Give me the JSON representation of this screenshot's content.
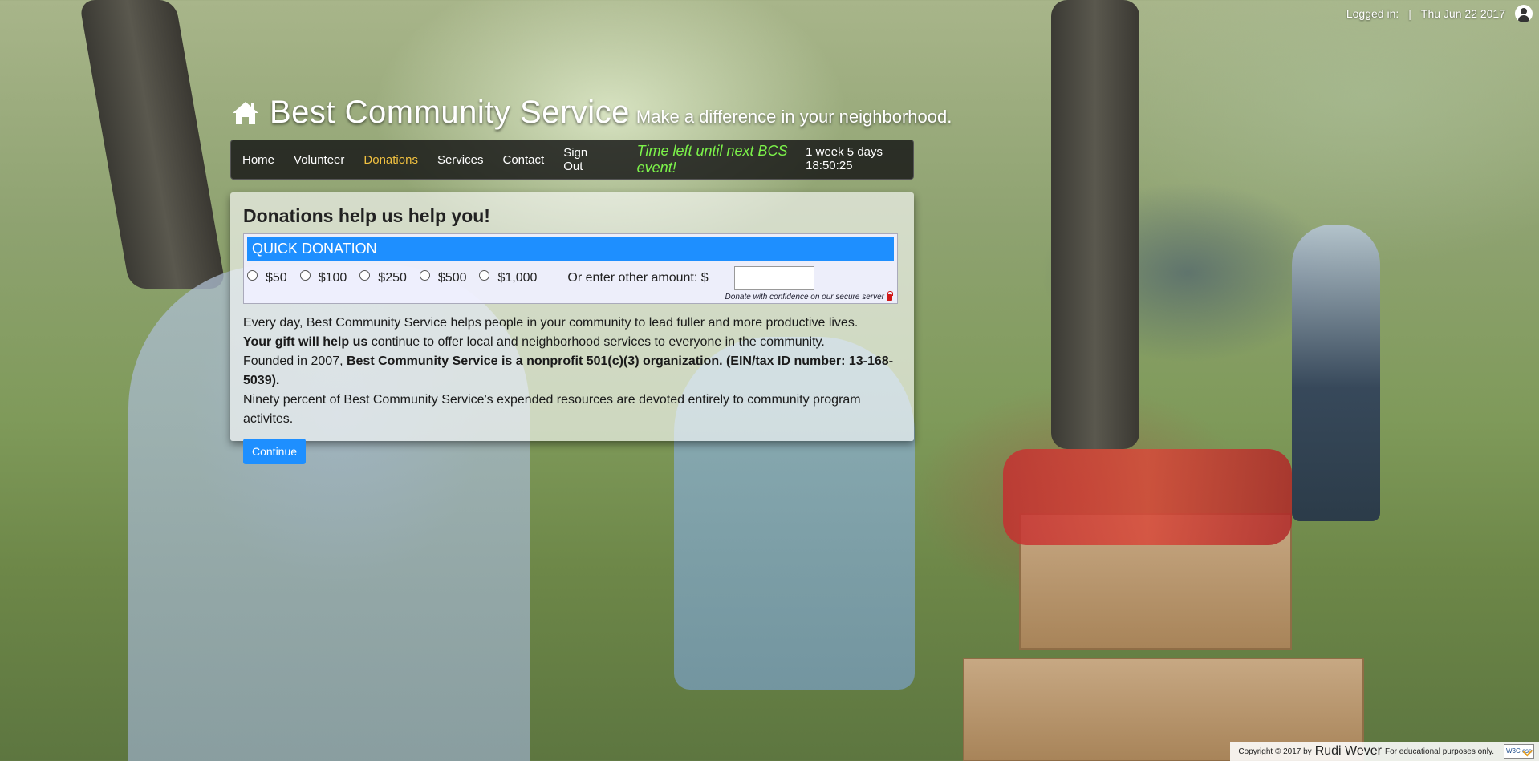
{
  "topbar": {
    "logged_in_label": "Logged in:",
    "separator": "|",
    "date": "Thu Jun 22 2017",
    "user_icon": "user-circle-icon"
  },
  "header": {
    "home_icon": "home-icon",
    "title": "Best Community Service",
    "tagline": "Make a difference in your neighborhood."
  },
  "nav": {
    "items": [
      {
        "label": "Home",
        "active": false
      },
      {
        "label": "Volunteer",
        "active": false
      },
      {
        "label": "Donations",
        "active": true
      },
      {
        "label": "Services",
        "active": false
      },
      {
        "label": "Contact",
        "active": false
      },
      {
        "label": "Sign Out",
        "active": false
      }
    ],
    "countdown_label": "Time left until next BCS event!",
    "countdown_value": "1 week 5 days 18:50:25"
  },
  "main": {
    "title": "Donations help us help you!",
    "quick_donation": {
      "header": "QUICK DONATION",
      "amounts": [
        "$50",
        "$100",
        "$250",
        "$500",
        "$1,000"
      ],
      "other_label": "Or enter other amount: $",
      "other_value": "",
      "secure_note": "Donate with confidence on our secure server"
    },
    "copy": {
      "line1": "Every day, Best Community Service helps people in your community to lead fuller and more productive lives.",
      "line2_bold": "Your gift will help us",
      "line2_rest": " continue to offer local and neighborhood services to everyone in the community.",
      "line3_start": "Founded in 2007, ",
      "line3_bold": "Best Community Service is a nonprofit 501(c)(3) organization.",
      "line3_end": " (EIN/tax ID number: 13-168-5039).",
      "line4": "Ninety percent of Best Community Service's expended resources are devoted entirely to community program activites."
    },
    "continue_label": "Continue"
  },
  "footer": {
    "copyright": "Copyright © 2017 by",
    "author": "Rudi Wever",
    "note": "For educational purposes only.",
    "badge": "W3C css"
  },
  "colors": {
    "accent": "#1e8fff",
    "nav_active": "#f0c040",
    "countdown": "#7cf24a"
  }
}
